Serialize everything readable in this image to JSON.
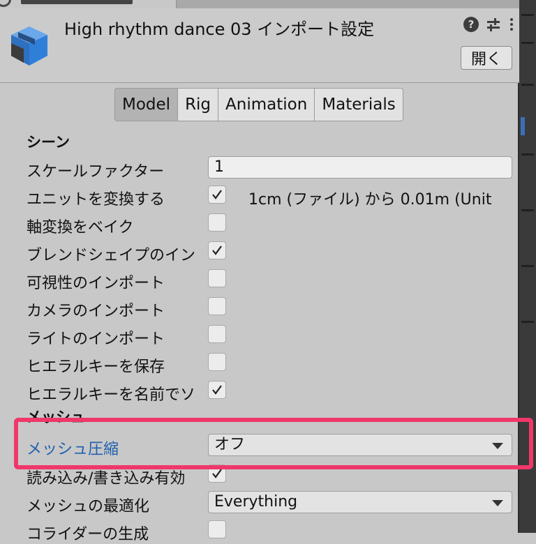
{
  "header": {
    "title": "High rhythm dance 03 インポート設定",
    "open_label": "開く",
    "help_label": "?"
  },
  "tabs": [
    {
      "label": "Model",
      "active": true
    },
    {
      "label": "Rig",
      "active": false
    },
    {
      "label": "Animation",
      "active": false
    },
    {
      "label": "Materials",
      "active": false
    }
  ],
  "scene": {
    "section_label": "シーン",
    "scale_factor_label": "スケールファクター",
    "scale_factor_value": "1",
    "convert_units_label": "ユニットを変換する",
    "convert_units_checked": true,
    "convert_units_note": "1cm (ファイル) から 0.01m (Unit",
    "bake_axis_label": "軸変換をベイク",
    "bake_axis_checked": false,
    "blendshapes_label": "ブレンドシェイプのイン",
    "blendshapes_checked": true,
    "visibility_label": "可視性のインポート",
    "visibility_checked": false,
    "cameras_label": "カメラのインポート",
    "cameras_checked": false,
    "lights_label": "ライトのインポート",
    "lights_checked": false,
    "preserve_hierarchy_label": "ヒエラルキーを保存",
    "preserve_hierarchy_checked": false,
    "sort_hierarchy_label": "ヒエラルキーを名前でソ",
    "sort_hierarchy_checked": true
  },
  "mesh": {
    "section_label": "メッシュ",
    "compression_label": "メッシュ圧縮",
    "compression_value": "オフ",
    "read_write_label": "読み込み/書き込み有効",
    "read_write_checked": true,
    "optimize_label": "メッシュの最適化",
    "optimize_value": "Everything",
    "colliders_label": "コライダーの生成",
    "colliders_checked": false
  },
  "colors": {
    "highlight": "#f0376a",
    "label_active": "#1f5fb0",
    "icon_blue": "#2f7fd8"
  }
}
